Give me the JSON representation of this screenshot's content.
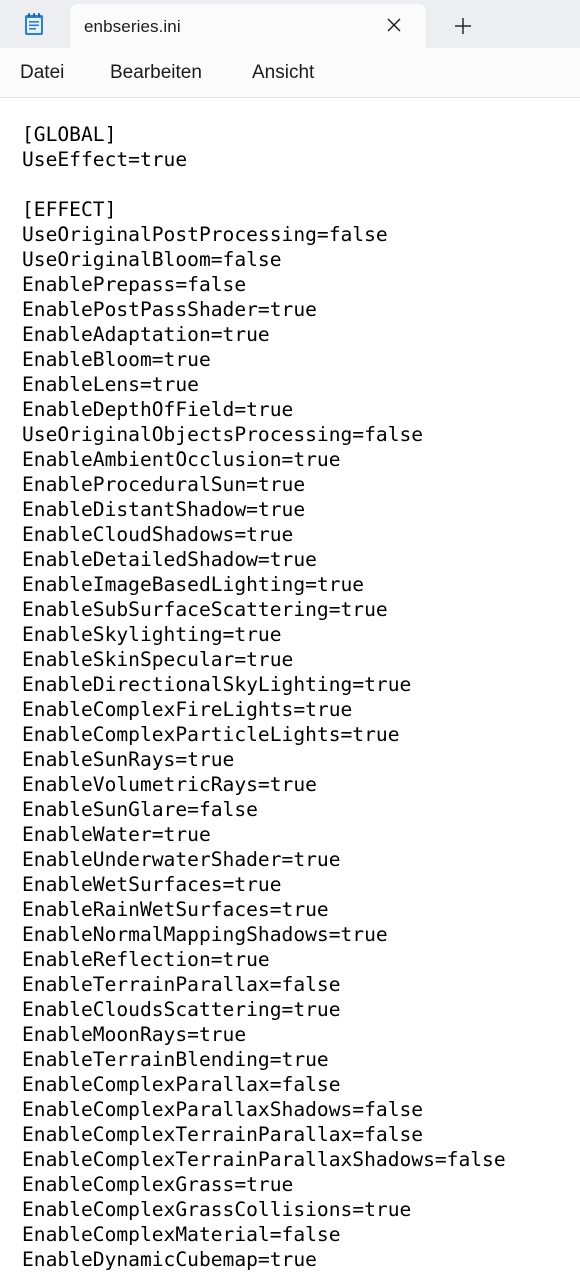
{
  "tab": {
    "title": "enbseries.ini",
    "close_icon": "close-icon",
    "new_tab_icon": "plus-icon"
  },
  "app_icon": "notepad-icon",
  "menu": {
    "file": "Datei",
    "edit": "Bearbeiten",
    "view": "Ansicht"
  },
  "editor": {
    "lines": [
      "[GLOBAL]",
      "UseEffect=true",
      "",
      "[EFFECT]",
      "UseOriginalPostProcessing=false",
      "UseOriginalBloom=false",
      "EnablePrepass=false",
      "EnablePostPassShader=true",
      "EnableAdaptation=true",
      "EnableBloom=true",
      "EnableLens=true",
      "EnableDepthOfField=true",
      "UseOriginalObjectsProcessing=false",
      "EnableAmbientOcclusion=true",
      "EnableProceduralSun=true",
      "EnableDistantShadow=true",
      "EnableCloudShadows=true",
      "EnableDetailedShadow=true",
      "EnableImageBasedLighting=true",
      "EnableSubSurfaceScattering=true",
      "EnableSkylighting=true",
      "EnableSkinSpecular=true",
      "EnableDirectionalSkyLighting=true",
      "EnableComplexFireLights=true",
      "EnableComplexParticleLights=true",
      "EnableSunRays=true",
      "EnableVolumetricRays=true",
      "EnableSunGlare=false",
      "EnableWater=true",
      "EnableUnderwaterShader=true",
      "EnableWetSurfaces=true",
      "EnableRainWetSurfaces=true",
      "EnableNormalMappingShadows=true",
      "EnableReflection=true",
      "EnableTerrainParallax=false",
      "EnableCloudsScattering=true",
      "EnableMoonRays=true",
      "EnableTerrainBlending=true",
      "EnableComplexParallax=false",
      "EnableComplexParallaxShadows=false",
      "EnableComplexTerrainParallax=false",
      "EnableComplexTerrainParallaxShadows=false",
      "EnableComplexGrass=true",
      "EnableComplexGrassCollisions=true",
      "EnableComplexMaterial=false",
      "EnableDynamicCubemap=true"
    ]
  }
}
